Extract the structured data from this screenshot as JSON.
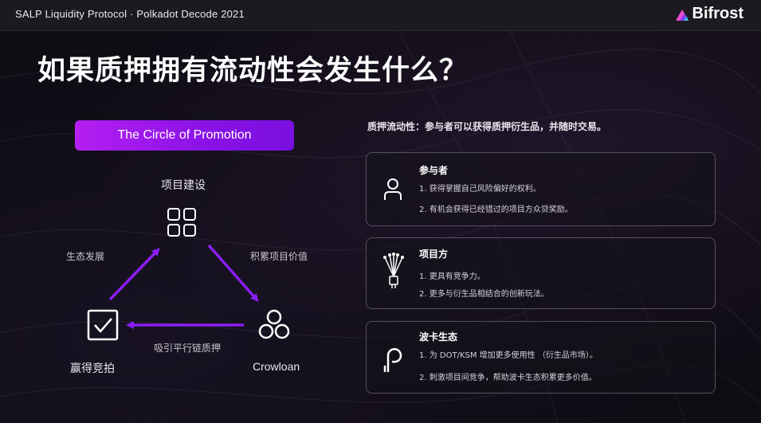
{
  "header": {
    "title": "SALP Liquidity Protocol · Polkadot Decode 2021",
    "logo_text": "Bifrost"
  },
  "slide": {
    "title": "如果质押拥有流动性会发生什么？",
    "promo_button": "The Circle of Promotion",
    "description": "质押流动性：参与者可以获得质押衍生品，并随时交易。"
  },
  "diagram": {
    "top_node": "项目建设",
    "left_node": "赢得竞拍",
    "right_node": "Crowloan",
    "arrow_left": "生态发展",
    "arrow_right": "积累项目价值",
    "arrow_bottom": "吸引平行链质押"
  },
  "cards": [
    {
      "icon": "person-icon",
      "title": "参与者",
      "lines": [
        "1. 获得掌握自己风险偏好的权利。",
        "2. 有机会获得已经错过的项目方众贷奖励。"
      ]
    },
    {
      "icon": "network-node-icon",
      "title": "项目方",
      "lines": [
        "1. 更具有竞争力。",
        "2. 更多与衍生品相结合的创新玩法。"
      ]
    },
    {
      "icon": "polkadot-icon",
      "title": "波卡生态",
      "lines": [
        "1. 为 DOT/KSM 增加更多使用性 （衍生品市场）。",
        "2. 刺激项目间竞争，帮助波卡生态积累更多价值。"
      ]
    }
  ],
  "colors": {
    "accent_purple": "#9b16f0",
    "arrow_purple": "#8b1ef5",
    "card_border": "#55525c"
  }
}
